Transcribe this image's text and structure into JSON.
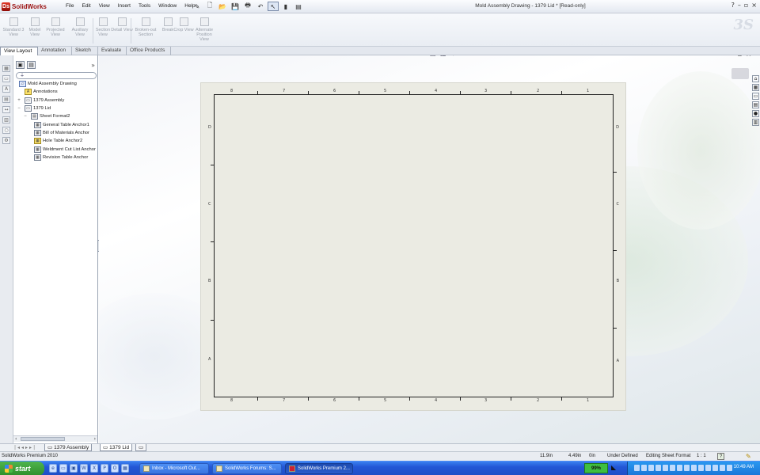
{
  "app": {
    "logo_text": "SolidWorks",
    "window_title": "Mold Assembly Drawing - 1379 Lid * [Read-only]",
    "help_glyph": "?",
    "window_controls": [
      "–",
      "▫",
      "×"
    ]
  },
  "menu": [
    "File",
    "Edit",
    "View",
    "Insert",
    "Tools",
    "Window",
    "Help"
  ],
  "command_manager": [
    {
      "label": "Standard 3 View"
    },
    {
      "label": "Model View"
    },
    {
      "label": "Projected View"
    },
    {
      "label": "Auxiliary View"
    },
    {
      "label": "Section View"
    },
    {
      "label": "Detail View"
    },
    {
      "label": "Broken-out Section"
    },
    {
      "label": "Break"
    },
    {
      "label": "Crop View"
    },
    {
      "label": "Alternate Position View"
    }
  ],
  "tabs": [
    "View Layout",
    "Annotation",
    "Sketch",
    "Evaluate",
    "Office Products"
  ],
  "active_tab": "View Layout",
  "feature_tree": {
    "filter_placeholder": "",
    "nodes": [
      {
        "label": "Mold Assembly Drawing",
        "level": 0,
        "icon": "drawing-icon",
        "expander": ""
      },
      {
        "label": "Annotations",
        "level": 1,
        "icon": "annotations-icon",
        "expander": ""
      },
      {
        "label": "1379 Assembly",
        "level": 1,
        "icon": "assembly-icon",
        "expander": "+"
      },
      {
        "label": "1379 Lid",
        "level": 1,
        "icon": "sheet-icon",
        "expander": "−"
      },
      {
        "label": "Sheet Format2",
        "level": 2,
        "icon": "sheet-format-icon",
        "expander": "−"
      },
      {
        "label": "General Table Anchor1",
        "level": 3,
        "icon": "table-anchor-icon",
        "expander": ""
      },
      {
        "label": "Bill of Materials Anchor",
        "level": 3,
        "icon": "bom-anchor-icon",
        "expander": ""
      },
      {
        "label": "Hole Table Anchor2",
        "level": 3,
        "icon": "hole-table-icon",
        "expander": ""
      },
      {
        "label": "Weldment Cut List Anchor",
        "level": 3,
        "icon": "weldment-icon",
        "expander": ""
      },
      {
        "label": "Revision Table Anchor",
        "level": 3,
        "icon": "revision-table-icon",
        "expander": ""
      }
    ]
  },
  "drawing": {
    "top_zones": [
      "8",
      "7",
      "6",
      "5",
      "4",
      "3",
      "2",
      "1"
    ],
    "bottom_zones": [
      "8",
      "7",
      "6",
      "5",
      "4",
      "3",
      "2",
      "1"
    ],
    "left_zones": [
      "D",
      "C",
      "B",
      "A"
    ],
    "right_zones": [
      "D",
      "C",
      "B",
      "A"
    ]
  },
  "sheet_tabs": [
    {
      "label": "1379 Assembly",
      "active": false
    },
    {
      "label": "1379 Lid",
      "active": true
    }
  ],
  "status": {
    "product": "SolidWorks Premium 2010",
    "x": "11.9in",
    "y": "4.49in",
    "z": "0in",
    "state": "Under Defined",
    "mode": "Editing Sheet Format",
    "scale": "1 : 1"
  },
  "taskbar": {
    "start_label": "start",
    "buttons": [
      {
        "label": "Inbox - Microsoft Out...",
        "active": false
      },
      {
        "label": "SolidWorks Forums: S...",
        "active": false
      },
      {
        "label": "SolidWorks Premium 2...",
        "active": true
      }
    ],
    "battery": "99%",
    "clock": "10:49 AM"
  },
  "colors": {
    "sheet": "#ebebe3",
    "accent_red": "#9b1010",
    "taskbar_blue": "#2357d6",
    "start_green": "#2e8f2b"
  }
}
